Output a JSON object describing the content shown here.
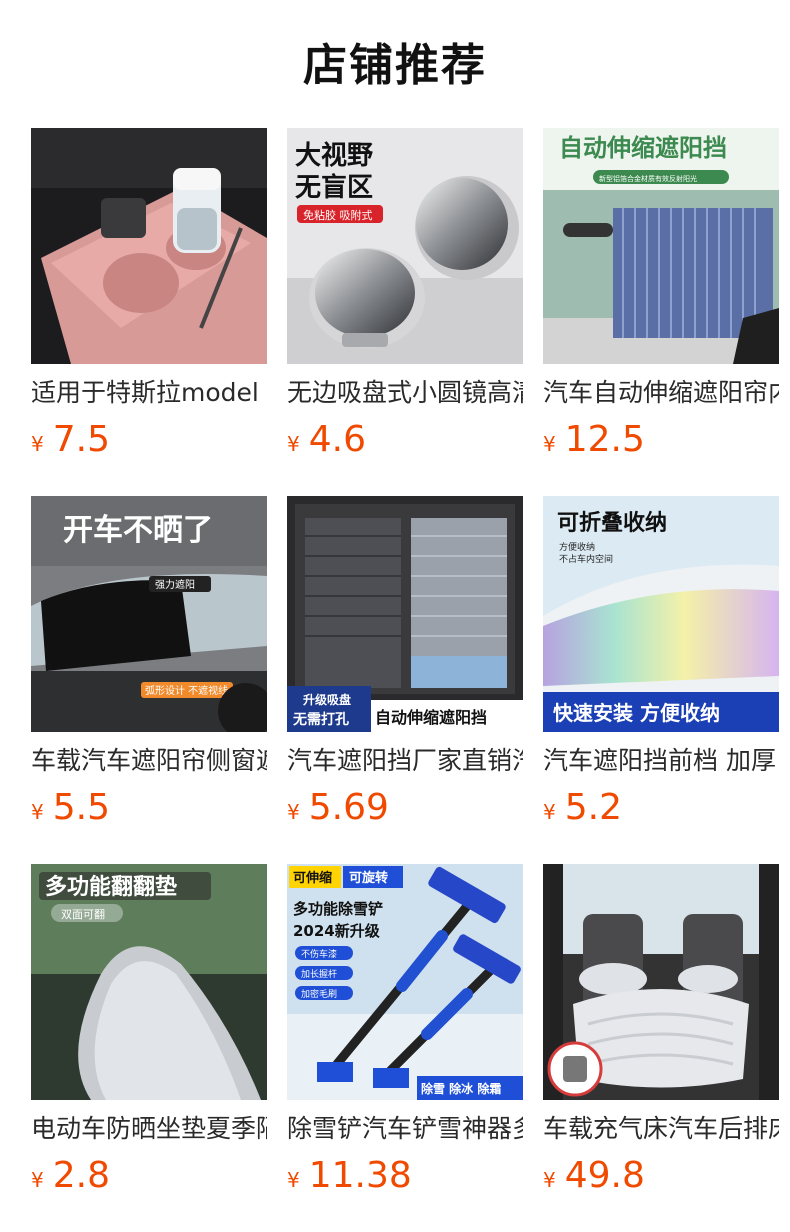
{
  "header": {
    "title": "店铺推荐"
  },
  "colors": {
    "price": "#f04a00"
  },
  "products": [
    {
      "name": "适用于特斯拉model",
      "currency": "¥",
      "price": "7.5",
      "icon": "pink-cup-holder-image"
    },
    {
      "name": "无边吸盘式小圆镜高清",
      "currency": "¥",
      "price": "4.6",
      "icon": "round-mirror-image",
      "image_text": [
        "大视野",
        "无盲区",
        "免粘胶 吸附式"
      ]
    },
    {
      "name": "汽车自动伸缩遮阳帘内",
      "currency": "¥",
      "price": "12.5",
      "icon": "retractable-sunshade-image",
      "image_text": [
        "自动伸缩遮阳挡",
        "新型铝箔合金材质有效反射阳光"
      ]
    },
    {
      "name": "车载汽车遮阳帘侧窗遮",
      "currency": "¥",
      "price": "5.5",
      "icon": "side-window-shade-image",
      "image_text": [
        "开车不晒了",
        "强力遮阳",
        "弧形设计 不遮视线"
      ]
    },
    {
      "name": "汽车遮阳挡厂家直销汽",
      "currency": "¥",
      "price": "5.69",
      "icon": "window-shade-pair-image",
      "image_text": [
        "升级吸盘",
        "无需打孔",
        "自动伸缩遮阳挡"
      ]
    },
    {
      "name": "汽车遮阳挡前档 加厚",
      "currency": "¥",
      "price": "5.2",
      "icon": "foldable-windshield-shade-image",
      "image_text": [
        "可折叠收纳",
        "方便收纳",
        "不占车内空间",
        "快速安装 方便收纳"
      ]
    },
    {
      "name": "电动车防晒坐垫夏季隔",
      "currency": "¥",
      "price": "2.8",
      "icon": "seat-cushion-image",
      "image_text": [
        "多功能翻翻垫",
        "双面可翻"
      ]
    },
    {
      "name": "除雪铲汽车铲雪神器多",
      "currency": "¥",
      "price": "11.38",
      "icon": "snow-shovel-image",
      "image_text": [
        "可伸缩",
        "可旋转",
        "多功能除雪铲",
        "2024新升级",
        "不伤车漆",
        "加长握杆",
        "加密毛刷",
        "除雪 除冰 除霜"
      ]
    },
    {
      "name": "车载充气床汽车后排床",
      "currency": "¥",
      "price": "49.8",
      "icon": "inflatable-bed-image"
    }
  ]
}
